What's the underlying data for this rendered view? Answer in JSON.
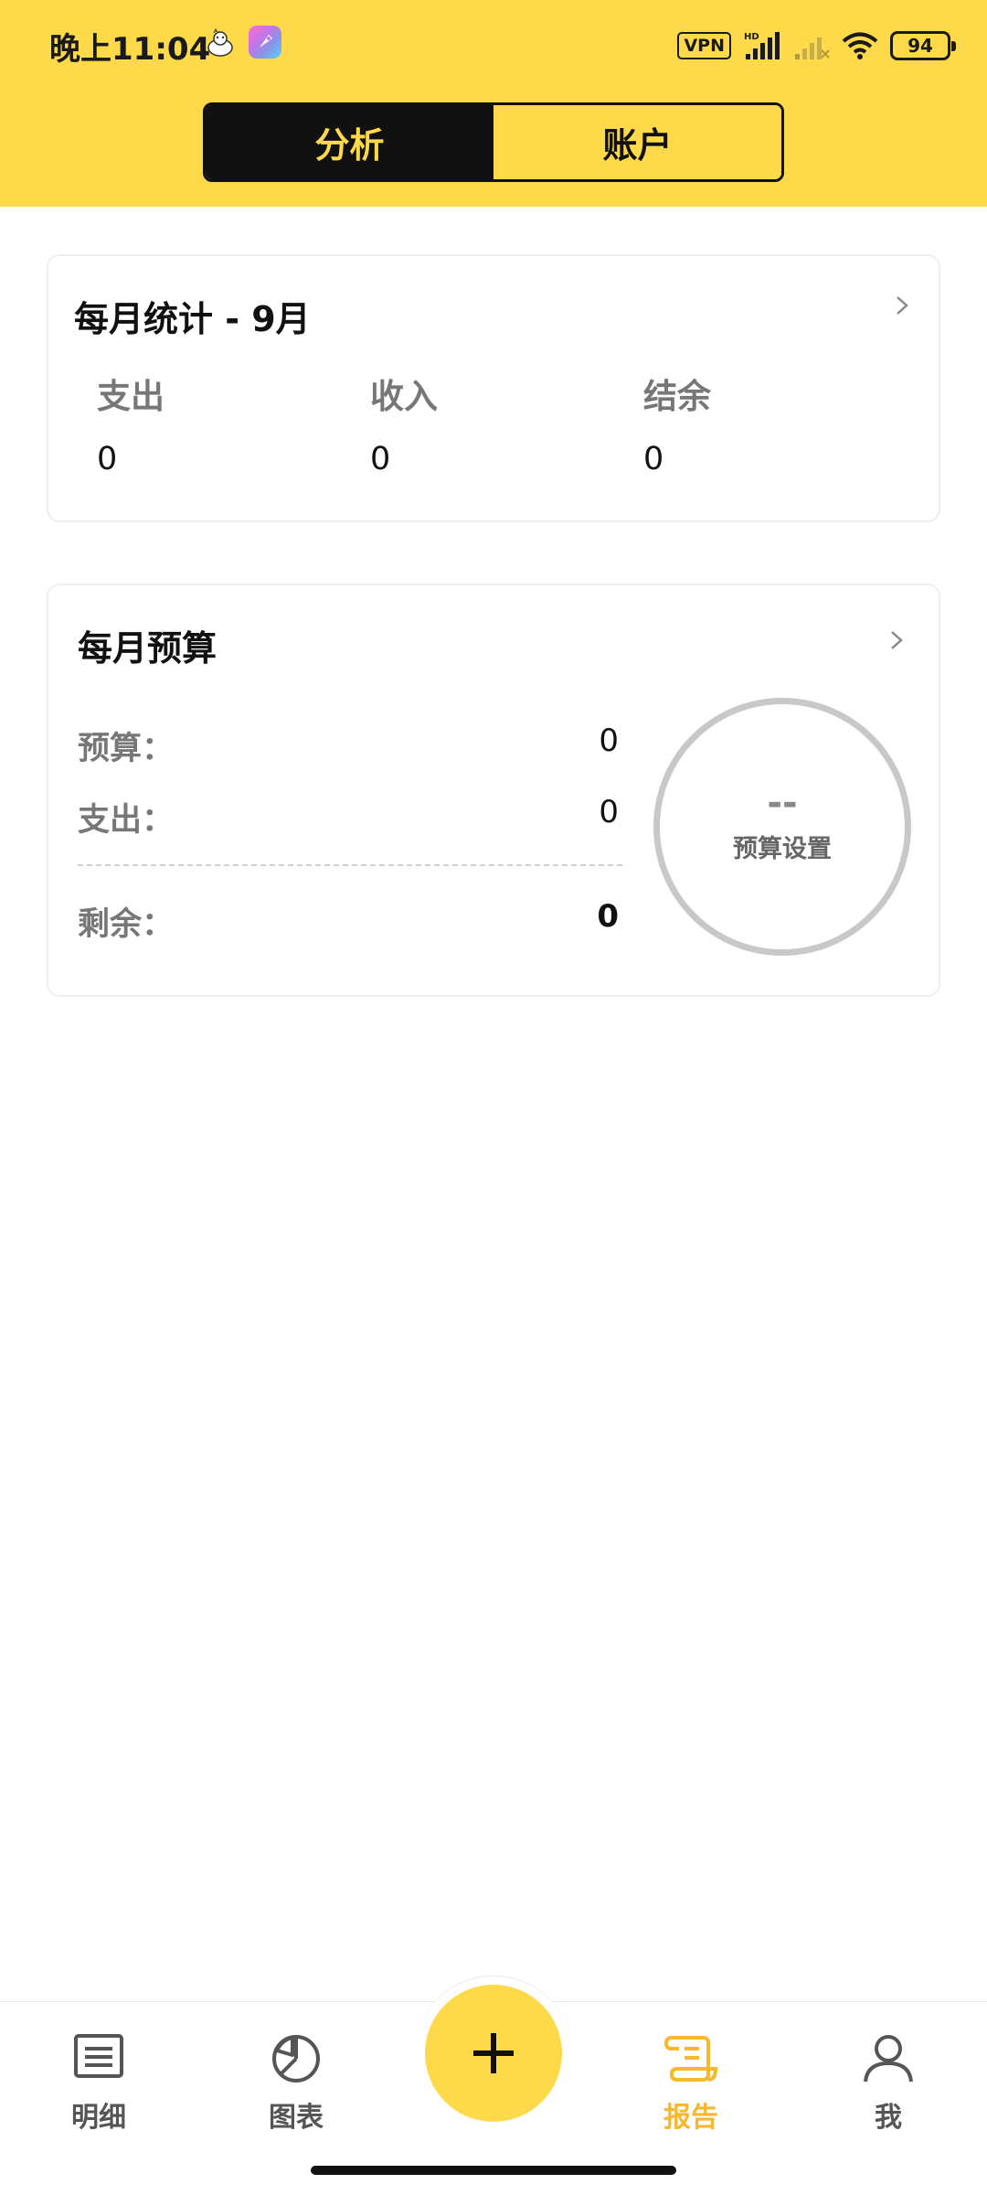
{
  "status_bar": {
    "time": "晚上11:04",
    "vpn": "VPN",
    "network": "HD",
    "battery": "94"
  },
  "tabs_top": {
    "analysis": "分析",
    "account": "账户"
  },
  "monthly_stats": {
    "title": "每月统计 - 9月",
    "expense_label": "支出",
    "expense_value": "0",
    "income_label": "收入",
    "income_value": "0",
    "balance_label": "结余",
    "balance_value": "0"
  },
  "monthly_budget": {
    "title": "每月预算",
    "budget_label": "预算：",
    "budget_value": "0",
    "spent_label": "支出：",
    "spent_value": "0",
    "remaining_label": "剩余：",
    "remaining_value": "0",
    "ring_value": "--",
    "ring_label": "预算设置"
  },
  "bottom_nav": {
    "items": [
      {
        "label": "明细",
        "icon": "list-icon"
      },
      {
        "label": "图表",
        "icon": "pie-chart-icon"
      },
      {
        "label": "报告",
        "icon": "report-scroll-icon",
        "active": true
      },
      {
        "label": "我",
        "icon": "user-icon"
      }
    ],
    "add_icon": "plus-icon"
  },
  "colors": {
    "accent": "#FED94A",
    "active_tab": "#F5B82E",
    "dark": "#111111"
  }
}
